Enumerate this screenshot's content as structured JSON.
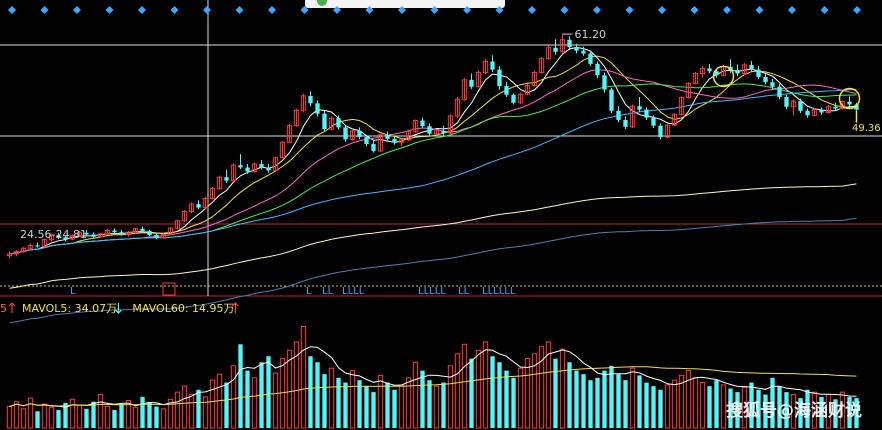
{
  "chart_data": {
    "type": "candlestick",
    "price_panel": {
      "high_label": "61.20",
      "right_label": "49.36",
      "range_label": "24.56-24.81",
      "markers": [
        "L",
        "LL",
        "LLLL",
        "LLLLL",
        "LL",
        "LLLLLL"
      ],
      "ylim": [
        20,
        64
      ],
      "ohlc": [
        [
          22.5,
          23.2,
          22.0,
          22.8
        ],
        [
          22.8,
          23.5,
          22.4,
          23.2
        ],
        [
          23.2,
          24.0,
          23.0,
          23.8
        ],
        [
          23.8,
          24.6,
          23.5,
          24.3
        ],
        [
          24.3,
          24.8,
          23.9,
          24.1
        ],
        [
          24.1,
          25.5,
          24.0,
          25.3
        ],
        [
          25.3,
          26.4,
          25.0,
          26.1
        ],
        [
          26.1,
          26.5,
          25.4,
          25.7
        ],
        [
          25.7,
          26.0,
          25.0,
          25.4
        ],
        [
          25.4,
          26.2,
          25.2,
          26.0
        ],
        [
          26.0,
          26.8,
          25.8,
          26.5
        ],
        [
          26.5,
          27.0,
          25.9,
          26.2
        ],
        [
          26.2,
          26.6,
          25.5,
          25.8
        ],
        [
          25.8,
          26.5,
          25.6,
          26.3
        ],
        [
          26.3,
          27.2,
          26.1,
          26.9
        ],
        [
          26.9,
          27.3,
          26.3,
          26.6
        ],
        [
          26.6,
          27.0,
          26.0,
          26.2
        ],
        [
          26.2,
          26.8,
          25.8,
          26.6
        ],
        [
          26.6,
          27.4,
          26.4,
          27.2
        ],
        [
          27.2,
          27.6,
          26.5,
          26.8
        ],
        [
          26.8,
          27.0,
          25.9,
          26.1
        ],
        [
          26.1,
          26.5,
          25.4,
          25.6
        ],
        [
          25.6,
          26.4,
          25.5,
          26.2
        ],
        [
          26.2,
          27.5,
          26.1,
          27.3
        ],
        [
          27.3,
          28.8,
          27.1,
          28.6
        ],
        [
          28.6,
          30.5,
          28.4,
          30.2
        ],
        [
          30.2,
          31.8,
          29.9,
          31.5
        ],
        [
          31.5,
          32.2,
          30.6,
          30.9
        ],
        [
          30.9,
          32.8,
          30.7,
          32.5
        ],
        [
          32.5,
          34.5,
          32.3,
          34.2
        ],
        [
          34.2,
          36.5,
          34.0,
          36.2
        ],
        [
          36.2,
          37.5,
          35.2,
          35.6
        ],
        [
          35.6,
          38.6,
          35.4,
          38.3
        ],
        [
          38.3,
          40.2,
          37.6,
          37.9
        ],
        [
          37.9,
          38.5,
          36.8,
          37.2
        ],
        [
          37.2,
          38.8,
          37.0,
          38.5
        ],
        [
          38.5,
          39.2,
          37.6,
          37.9
        ],
        [
          37.9,
          38.5,
          37.0,
          37.4
        ],
        [
          37.4,
          39.8,
          37.3,
          39.6
        ],
        [
          39.6,
          42.5,
          39.5,
          42.3
        ],
        [
          42.3,
          45.5,
          42.1,
          45.2
        ],
        [
          45.2,
          48.2,
          45.0,
          47.9
        ],
        [
          47.9,
          50.8,
          47.5,
          50.4
        ],
        [
          50.4,
          51.2,
          48.6,
          49.1
        ],
        [
          49.1,
          49.6,
          46.8,
          47.3
        ],
        [
          47.3,
          47.8,
          44.2,
          44.6
        ],
        [
          44.6,
          46.8,
          44.4,
          46.5
        ],
        [
          46.5,
          47.0,
          44.5,
          44.9
        ],
        [
          44.9,
          45.3,
          42.4,
          42.8
        ],
        [
          42.8,
          44.6,
          42.6,
          44.3
        ],
        [
          44.3,
          44.9,
          42.8,
          43.2
        ],
        [
          43.2,
          43.6,
          41.6,
          42.0
        ],
        [
          42.0,
          42.5,
          40.5,
          40.8
        ],
        [
          40.8,
          43.8,
          40.6,
          43.6
        ],
        [
          43.6,
          44.2,
          42.5,
          42.9
        ],
        [
          42.9,
          43.4,
          41.9,
          42.3
        ],
        [
          42.3,
          43.0,
          41.6,
          42.7
        ],
        [
          42.7,
          44.5,
          42.5,
          44.2
        ],
        [
          44.2,
          46.3,
          44.0,
          46.1
        ],
        [
          46.1,
          46.6,
          44.7,
          45.1
        ],
        [
          45.1,
          45.6,
          43.4,
          43.8
        ],
        [
          43.8,
          44.5,
          43.5,
          44.3
        ],
        [
          44.3,
          45.2,
          43.5,
          43.9
        ],
        [
          43.9,
          47.2,
          43.7,
          46.9
        ],
        [
          46.9,
          50.2,
          46.6,
          49.8
        ],
        [
          49.8,
          53.5,
          49.6,
          53.2
        ],
        [
          53.2,
          54.3,
          51.6,
          52.0
        ],
        [
          52.0,
          54.8,
          51.8,
          54.5
        ],
        [
          54.5,
          56.8,
          54.2,
          56.4
        ],
        [
          56.4,
          57.5,
          54.6,
          55.0
        ],
        [
          55.0,
          55.6,
          51.5,
          52.1
        ],
        [
          52.1,
          52.8,
          50.2,
          50.6
        ],
        [
          50.6,
          50.8,
          48.9,
          49.2
        ],
        [
          49.2,
          51.0,
          49.0,
          50.7
        ],
        [
          50.7,
          52.5,
          50.5,
          52.2
        ],
        [
          52.2,
          54.8,
          52.0,
          54.5
        ],
        [
          54.5,
          57.2,
          54.3,
          56.9
        ],
        [
          56.9,
          59.2,
          56.7,
          58.8
        ],
        [
          58.8,
          60.3,
          57.6,
          58.1
        ],
        [
          58.1,
          61.2,
          58.0,
          60.2
        ],
        [
          60.2,
          60.8,
          58.4,
          58.9
        ],
        [
          58.9,
          59.5,
          57.8,
          58.3
        ],
        [
          58.3,
          59.0,
          57.4,
          57.8
        ],
        [
          57.8,
          58.2,
          55.6,
          56.0
        ],
        [
          56.0,
          56.4,
          53.5,
          54.0
        ],
        [
          54.0,
          54.5,
          51.0,
          51.5
        ],
        [
          51.5,
          51.8,
          47.4,
          47.8
        ],
        [
          47.8,
          48.6,
          45.8,
          46.2
        ],
        [
          46.2,
          46.8,
          44.6,
          45.0
        ],
        [
          45.0,
          48.9,
          44.8,
          48.6
        ],
        [
          48.6,
          50.2,
          47.6,
          48.0
        ],
        [
          48.0,
          48.4,
          46.2,
          46.6
        ],
        [
          46.6,
          47.0,
          44.8,
          45.2
        ],
        [
          45.2,
          45.6,
          42.8,
          43.2
        ],
        [
          43.2,
          45.5,
          43.0,
          45.3
        ],
        [
          45.3,
          47.4,
          45.1,
          47.2
        ],
        [
          47.2,
          50.3,
          47.0,
          50.1
        ],
        [
          50.1,
          52.8,
          49.9,
          52.6
        ],
        [
          52.6,
          54.6,
          52.4,
          54.3
        ],
        [
          54.3,
          55.6,
          53.6,
          55.2
        ],
        [
          55.2,
          56.0,
          54.3,
          54.7
        ],
        [
          54.7,
          55.2,
          53.6,
          54.0
        ],
        [
          54.0,
          55.8,
          53.8,
          55.5
        ],
        [
          55.5,
          56.8,
          54.4,
          54.9
        ],
        [
          54.9,
          55.9,
          53.8,
          54.3
        ],
        [
          54.3,
          56.2,
          54.0,
          55.8
        ],
        [
          55.8,
          56.5,
          54.6,
          55.0
        ],
        [
          55.0,
          55.6,
          53.3,
          53.7
        ],
        [
          53.7,
          54.2,
          52.4,
          52.8
        ],
        [
          52.8,
          53.4,
          51.6,
          52.0
        ],
        [
          52.0,
          52.5,
          49.8,
          50.2
        ],
        [
          50.2,
          50.6,
          48.1,
          48.5
        ],
        [
          48.5,
          49.8,
          47.0,
          49.5
        ],
        [
          49.5,
          49.9,
          47.4,
          47.8
        ],
        [
          47.8,
          48.2,
          46.6,
          47.0
        ],
        [
          47.0,
          48.3,
          46.8,
          48.0
        ],
        [
          48.0,
          48.4,
          47.1,
          47.5
        ],
        [
          47.5,
          48.8,
          47.3,
          48.5
        ],
        [
          48.5,
          49.2,
          47.9,
          48.2
        ],
        [
          48.2,
          49.6,
          48.0,
          49.4
        ],
        [
          49.4,
          50.3,
          48.5,
          48.9
        ],
        [
          48.9,
          49.2,
          47.8,
          48.0
        ]
      ]
    },
    "volume_panel": {
      "legend": [
        {
          "text": "MAVOL5: 34.07万",
          "arrow": "↓",
          "arrow_color": "#54f5fa"
        },
        {
          "text": "MAVOL60: 14.95万",
          "arrow": "↑",
          "arrow_color": "#ff4444"
        }
      ],
      "ylim": [
        0,
        92
      ],
      "values": [
        18,
        22,
        16,
        25,
        14,
        20,
        17,
        15,
        21,
        24,
        19,
        16,
        22,
        28,
        18,
        15,
        20,
        23,
        17,
        26,
        21,
        18,
        16,
        24,
        30,
        35,
        28,
        32,
        26,
        40,
        45,
        38,
        52,
        70,
        48,
        42,
        55,
        60,
        46,
        58,
        65,
        72,
        85,
        60,
        55,
        45,
        50,
        42,
        38,
        48,
        40,
        35,
        30,
        44,
        38,
        32,
        36,
        42,
        55,
        48,
        40,
        35,
        38,
        52,
        62,
        70,
        58,
        65,
        72,
        60,
        55,
        48,
        42,
        50,
        58,
        62,
        68,
        72,
        58,
        66,
        55,
        48,
        45,
        40,
        42,
        48,
        52,
        45,
        40,
        50,
        44,
        38,
        35,
        32,
        36,
        40,
        44,
        48,
        42,
        38,
        35,
        40,
        36,
        33,
        30,
        34,
        38,
        32,
        28,
        42,
        35,
        30,
        28,
        25,
        32,
        30,
        26,
        28,
        24,
        30,
        26,
        25
      ]
    }
  },
  "watermark": "搜狐号@海涵财说",
  "icons": {
    "diamond": "diamond-icon",
    "signal_box": "signal-q-icon"
  }
}
